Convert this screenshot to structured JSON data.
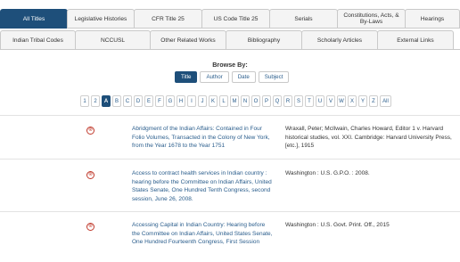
{
  "tabs": {
    "row1": [
      {
        "label": "All Titles",
        "active": true
      },
      {
        "label": "Legislative Histories",
        "active": false
      },
      {
        "label": "CFR Title 25",
        "active": false
      },
      {
        "label": "US Code Title 25",
        "active": false
      },
      {
        "label": "Serials",
        "active": false
      },
      {
        "label": "Constitutions, Acts, & By-Laws",
        "active": false
      },
      {
        "label": "Hearings",
        "active": false
      }
    ],
    "row2": [
      {
        "label": "Indian Tribal Codes",
        "active": false
      },
      {
        "label": "NCCUSL",
        "active": false
      },
      {
        "label": "Other Related Works",
        "active": false
      },
      {
        "label": "Bibliography",
        "active": false
      },
      {
        "label": "Scholarly Articles",
        "active": false
      },
      {
        "label": "External Links",
        "active": false
      }
    ]
  },
  "browse": {
    "label": "Browse By:",
    "options": [
      {
        "label": "Title",
        "active": true
      },
      {
        "label": "Author",
        "active": false
      },
      {
        "label": "Date",
        "active": false
      },
      {
        "label": "Subject",
        "active": false
      }
    ]
  },
  "alphabet": {
    "items": [
      "1",
      "2",
      "A",
      "B",
      "C",
      "D",
      "E",
      "F",
      "G",
      "H",
      "I",
      "J",
      "K",
      "L",
      "M",
      "N",
      "O",
      "P",
      "Q",
      "R",
      "S",
      "T",
      "U",
      "V",
      "W",
      "X",
      "Y",
      "Z",
      "All"
    ],
    "active": "A"
  },
  "results": [
    {
      "icon": "registered-icon",
      "icon_glyph": "®",
      "title": "Abridgment of the Indian Affairs: Contained in Four Folio Volumes, Transacted in the Colony of New York, from the Year 1678 to the Year 1751",
      "publication": "Wraxall, Peter; McIlwain, Charles Howard, Editor 1 v. Harvard historical studies, vol. XXI. Cambridge: Harvard University Press, [etc.], 1915"
    },
    {
      "icon": "registered-icon",
      "icon_glyph": "®",
      "title": "Access to contract health services in Indian country : hearing before the Committee on Indian Affairs, United States Senate, One Hundred Tenth Congress, second session, June 26, 2008.",
      "publication": "Washington : U.S. G.P.O. : 2008."
    },
    {
      "icon": "registered-icon",
      "icon_glyph": "®",
      "title": "Accessing Capital in Indian Country: Hearing before the Committee on Indian Affairs, United States Senate, One Hundred Fourteenth Congress, First Session",
      "publication": "Washington : U.S. Govt. Print. Off., 2015"
    }
  ],
  "colors": {
    "accent": "#1e4f7a",
    "link": "#2a5d8c",
    "icon_red": "#c0392b"
  }
}
